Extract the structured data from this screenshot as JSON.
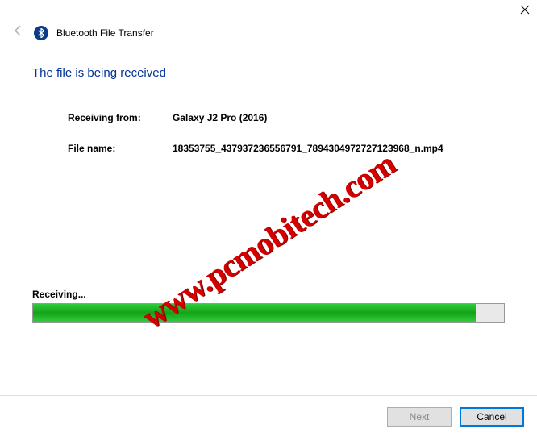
{
  "window": {
    "title": "Bluetooth File Transfer"
  },
  "main": {
    "headline": "The file is being received",
    "receiving_from_label": "Receiving from:",
    "receiving_from_value": "Galaxy J2 Pro (2016)",
    "file_name_label": "File name:",
    "file_name_value": "18353755_437937236556791_7894304972727123968_n.mp4"
  },
  "progress": {
    "label": "Receiving...",
    "percent": 94
  },
  "footer": {
    "next_label": "Next",
    "cancel_label": "Cancel"
  },
  "watermark": {
    "text": "www.pcmobitech.com"
  }
}
